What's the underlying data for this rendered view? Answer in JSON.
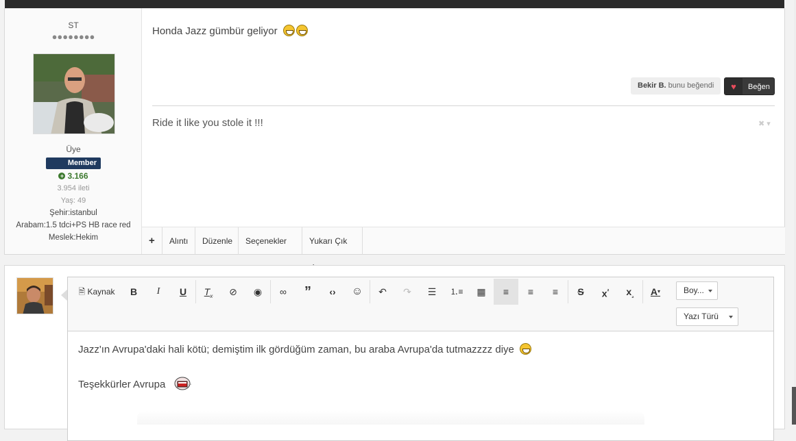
{
  "post": {
    "user": {
      "name": "ST",
      "rank_dots": "●●●●●●●●",
      "role": "Üye",
      "badge": "Member",
      "reputation": "3.166",
      "post_count": "3.954 ileti",
      "age": "Yaş: 49",
      "city": "Şehir:istanbul",
      "car": "Arabam:1.5 tdci+PS HB race red",
      "job": "Meslek:Hekim"
    },
    "message": "Honda Jazz gümbür geliyor",
    "likers_name": "Bekir B.",
    "likers_suffix": "bunu beğendi",
    "like_button": "Beğen",
    "signature": "Ride it like you stole it !!!",
    "sig_controls": "✖ ▾",
    "actions": {
      "add": "+",
      "quote": "Alıntı",
      "edit": "Düzenle",
      "options": "Seçenekler",
      "top": "Yukarı Çık"
    }
  },
  "editor": {
    "source_label": "Kaynak",
    "size_dropdown": "Boy...",
    "font_dropdown": "Yazı Türü",
    "line1": "Jazz'ın Avrupa'daki hali kötü; demiştim ilk gördüğüm zaman, bu araba Avrupa'da tutmazzzz diye",
    "line2": "Teşekkürler Avrupa",
    "icons": [
      "source-icon",
      "bold-icon",
      "italic-icon",
      "underline-icon",
      "remove-format-icon",
      "hide-icon",
      "preview-icon",
      "link-icon",
      "quote-icon",
      "code-icon",
      "smiley-icon",
      "undo-icon",
      "redo-icon",
      "bulleted-list-icon",
      "numbered-list-icon",
      "table-icon",
      "align-left-icon",
      "align-center-icon",
      "align-right-icon",
      "strikethrough-icon",
      "superscript-icon",
      "subscript-icon",
      "text-color-icon"
    ]
  },
  "colors": {
    "badge": "#1f3a5f",
    "reputation": "#3e7a2f",
    "like_button": "#3a3a3a",
    "heart": "#e74c5c"
  }
}
